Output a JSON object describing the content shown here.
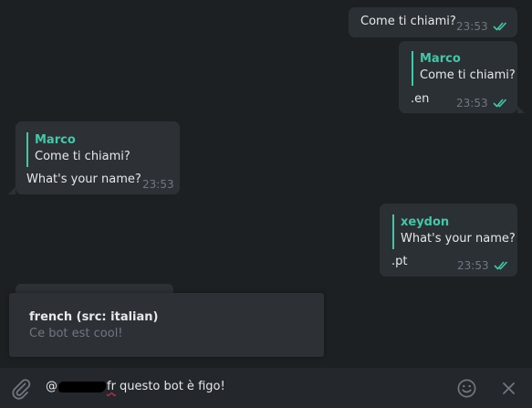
{
  "messages": [
    {
      "id": "m1",
      "text": "Come ti chiami?",
      "time": "23:53"
    },
    {
      "id": "m2",
      "reply_name": "Marco",
      "reply_text": "Come ti chiami?",
      "text": ".en",
      "time": "23:53"
    },
    {
      "id": "m3",
      "reply_name": "Marco",
      "reply_text": "Come ti chiami?",
      "text": "What's your name?",
      "time": "23:53"
    },
    {
      "id": "m4",
      "reply_name": "xeydon",
      "reply_text": "What's your name?",
      "text": ".pt",
      "time": "23:53"
    }
  ],
  "inline_result": {
    "title": "french (src: italian)",
    "description": "Ce bot est cool!"
  },
  "composer": {
    "prefix": "@",
    "command": "fr",
    "text": " questo bot è figo!"
  },
  "colors": {
    "accent": "#41c9a7",
    "background": "#1d2023",
    "bubble": "#2d3136"
  },
  "icons": {
    "attach": "paperclip-icon",
    "emoji": "smiley-icon",
    "close": "close-icon",
    "read": "double-check-icon"
  }
}
